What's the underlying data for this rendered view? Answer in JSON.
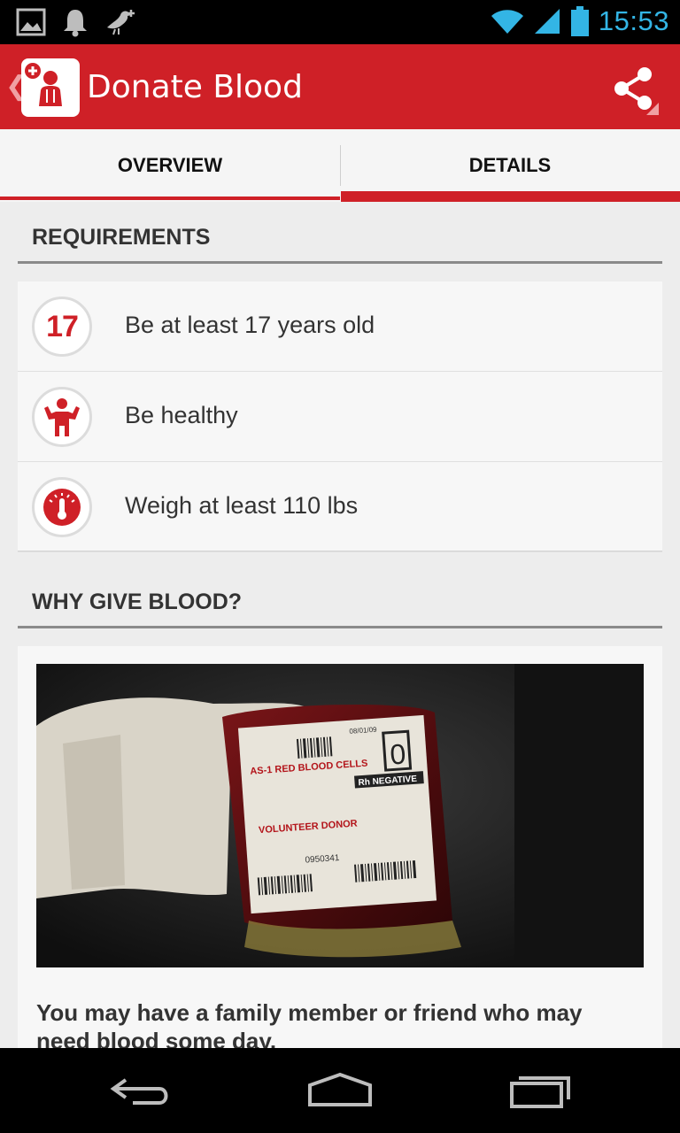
{
  "status_bar": {
    "time": "15:53",
    "icons": [
      "image-icon",
      "bell-icon",
      "bird-icon",
      "wifi-icon",
      "signal-icon",
      "battery-icon"
    ]
  },
  "action_bar": {
    "title": "Donate Blood",
    "background_color": "#cf2027",
    "icons": [
      "back-chevron-icon",
      "app-logo",
      "share-icon",
      "overflow-corner-icon"
    ]
  },
  "tabs": [
    {
      "label": "OVERVIEW",
      "selected": false
    },
    {
      "label": "DETAILS",
      "selected": true
    }
  ],
  "requirements": {
    "header": "REQUIREMENTS",
    "items": [
      {
        "icon_text": "17",
        "icon": "age-17-icon",
        "label": "Be at least 17 years old"
      },
      {
        "icon": "healthy-person-icon",
        "label": "Be healthy"
      },
      {
        "icon": "scale-gauge-icon",
        "label": "Weigh at least 110 lbs"
      }
    ]
  },
  "why": {
    "header": "WHY GIVE BLOOD?",
    "image": {
      "label_lines": [
        "AS-1 RED BLOOD CELLS",
        "VOLUNTEER DONOR",
        "Rh NEGATIVE",
        "0",
        "0950341",
        "08/01/09"
      ]
    },
    "text": "You may have a family member or friend who may need blood some day."
  },
  "nav_bar": {
    "icons": [
      "back-icon",
      "home-icon",
      "recent-apps-icon"
    ]
  }
}
